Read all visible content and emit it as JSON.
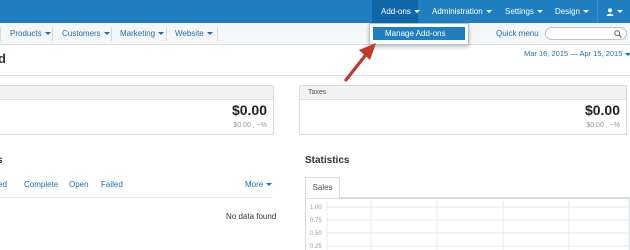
{
  "topnav": {
    "addons": "Add-ons",
    "administration": "Administration",
    "settings": "Settings",
    "design": "Design"
  },
  "dropdown": {
    "manage_addons": "Manage Add-ons"
  },
  "subnav": {
    "products": "Products",
    "customers": "Customers",
    "marketing": "Marketing",
    "website": "Website",
    "quick_menu": "Quick menu"
  },
  "page": {
    "title": "d",
    "date_range": "Mar 16, 2015 — Apr 15, 2015"
  },
  "cards": {
    "left": {
      "amount": "$0.00",
      "sub": "$0.00 , −%"
    },
    "taxes": {
      "title": "Taxes",
      "amount": "$0.00",
      "sub": "$0.00 , −%"
    }
  },
  "orders": {
    "title": "s",
    "tabs": [
      "ed",
      "Complete",
      "Open",
      "Failed"
    ],
    "more": "More",
    "empty": "No data found"
  },
  "statistics": {
    "title": "Statistics",
    "tab": "Sales",
    "y_ticks": [
      "1.00",
      "0.75",
      "0.50",
      "0.25"
    ]
  },
  "colors": {
    "topbar": "#1f7fc1",
    "link": "#1f6fae",
    "arrow": "#c0392b"
  }
}
